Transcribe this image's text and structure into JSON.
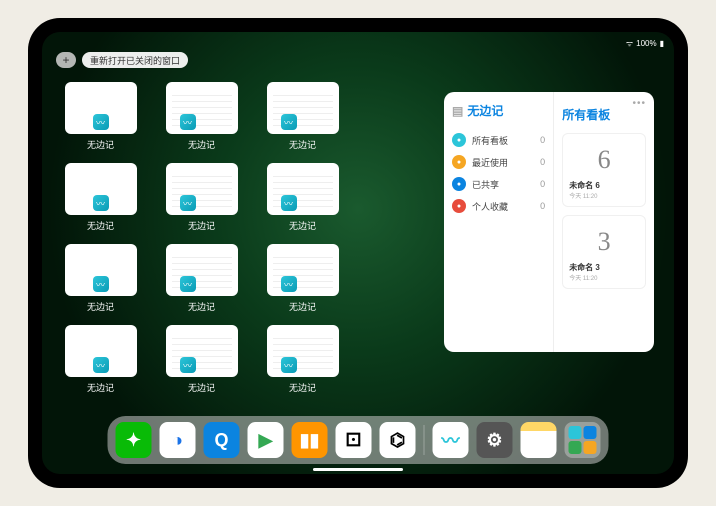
{
  "status": {
    "time": "",
    "battery": "100%"
  },
  "reopen_btn": "重新打开已关闭的窗口",
  "app_label": "无边记",
  "panel": {
    "left_title": "无边记",
    "right_title": "所有看板",
    "categories": [
      {
        "icon_color": "#2cc5d9",
        "label": "所有看板",
        "count": 0
      },
      {
        "icon_color": "#f5a623",
        "label": "最近使用",
        "count": 0
      },
      {
        "icon_color": "#0b84e0",
        "label": "已共享",
        "count": 0
      },
      {
        "icon_color": "#e74c3c",
        "label": "个人收藏",
        "count": 0
      }
    ],
    "boards": [
      {
        "glyph": "6",
        "name": "未命名 6",
        "sub": "今天 11:20"
      },
      {
        "glyph": "3",
        "name": "未命名 3",
        "sub": "今天 11:20"
      }
    ]
  },
  "dock": [
    {
      "name": "wechat",
      "bg": "#09bb07",
      "glyph": "✦"
    },
    {
      "name": "quark-hd",
      "bg": "#fff",
      "glyph": "◑",
      "fg": "#1a73e8"
    },
    {
      "name": "quark",
      "bg": "#0b84e0",
      "glyph": "Q"
    },
    {
      "name": "play",
      "bg": "#fff",
      "glyph": "▶",
      "fg": "#34a853"
    },
    {
      "name": "books",
      "bg": "#ff9500",
      "glyph": "▮▮"
    },
    {
      "name": "roll",
      "bg": "#fff",
      "glyph": "⚀",
      "fg": "#000"
    },
    {
      "name": "graph",
      "bg": "#fff",
      "glyph": "⌬",
      "fg": "#000"
    },
    {
      "name": "freeform",
      "bg": "#fff",
      "glyph": "〰",
      "fg": "#2cc5d9"
    },
    {
      "name": "settings",
      "bg": "#555",
      "glyph": "⚙"
    },
    {
      "name": "notes",
      "bg": "linear-gradient(#ffd766 25%,#fff 25%)",
      "glyph": ""
    }
  ]
}
